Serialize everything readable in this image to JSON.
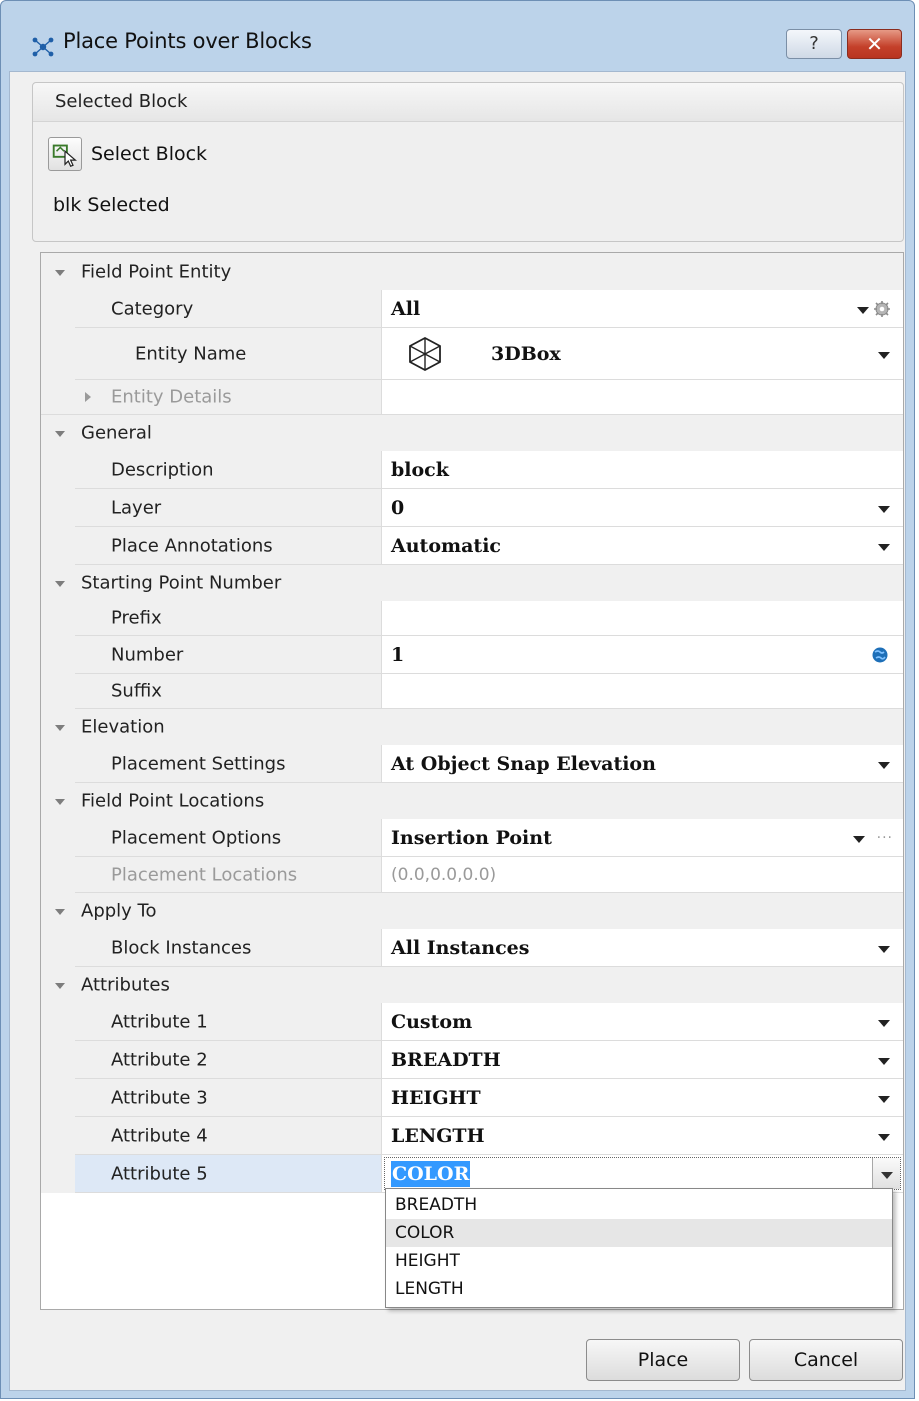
{
  "window": {
    "title": "Place Points over Blocks",
    "help_label": "?",
    "close_label": "✕"
  },
  "selected_block": {
    "header": "Selected Block",
    "select_button_label": "Select Block",
    "status": "blk Selected"
  },
  "grid": {
    "field_point_entity": {
      "title": "Field Point Entity",
      "category_label": "Category",
      "category_value": "All",
      "entity_name_label": "Entity Name",
      "entity_name_value": "3DBox",
      "entity_details_label": "Entity Details"
    },
    "general": {
      "title": "General",
      "description_label": "Description",
      "description_value": "block",
      "layer_label": "Layer",
      "layer_value": "0",
      "place_annotations_label": "Place Annotations",
      "place_annotations_value": "Automatic"
    },
    "starting_point_number": {
      "title": "Starting Point Number",
      "prefix_label": "Prefix",
      "prefix_value": "",
      "number_label": "Number",
      "number_value": "1",
      "suffix_label": "Suffix",
      "suffix_value": ""
    },
    "elevation": {
      "title": "Elevation",
      "placement_settings_label": "Placement Settings",
      "placement_settings_value": "At Object Snap Elevation"
    },
    "field_point_locations": {
      "title": "Field Point Locations",
      "placement_options_label": "Placement Options",
      "placement_options_value": "Insertion Point",
      "placement_locations_label": "Placement Locations",
      "placement_locations_value": "(0.0,0.0,0.0)"
    },
    "apply_to": {
      "title": "Apply To",
      "block_instances_label": "Block Instances",
      "block_instances_value": "All Instances"
    },
    "attributes": {
      "title": "Attributes",
      "attr1_label": "Attribute 1",
      "attr1_value": "Custom",
      "attr2_label": "Attribute 2",
      "attr2_value": "BREADTH",
      "attr3_label": "Attribute 3",
      "attr3_value": "HEIGHT",
      "attr4_label": "Attribute 4",
      "attr4_value": "LENGTH",
      "attr5_label": "Attribute 5",
      "attr5_value": "COLOR"
    }
  },
  "dropdown_options": [
    "BREADTH",
    "COLOR",
    "HEIGHT",
    "LENGTH"
  ],
  "buttons": {
    "place": "Place",
    "cancel": "Cancel"
  },
  "colors": {
    "selection": "#3399ff",
    "titlebar": "#bcd3ea",
    "close": "#c4402a"
  }
}
